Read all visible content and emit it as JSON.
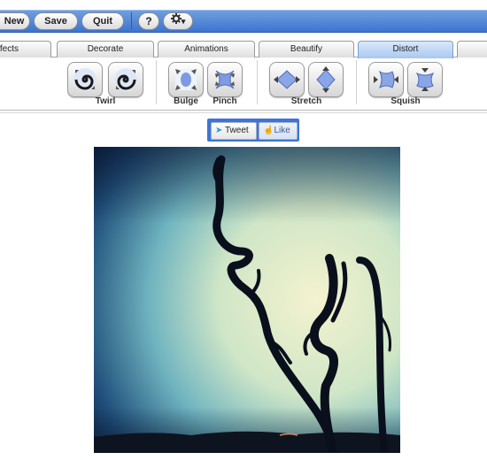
{
  "toolbar": {
    "new_label": "New",
    "save_label": "Save",
    "quit_label": "Quit",
    "help_label": "?",
    "settings_icon": "gear-icon",
    "settings_arrow": "▾"
  },
  "tabs": [
    "Effects",
    "Decorate",
    "Animations",
    "Beautify",
    "Distort",
    ""
  ],
  "active_tab": "Distort",
  "tool_groups": [
    {
      "label": "Twirl",
      "tools": [
        "twirl-left-icon",
        "twirl-right-icon"
      ]
    },
    {
      "label": "Bulge",
      "tools": [
        "bulge-icon"
      ]
    },
    {
      "label": "Pinch",
      "tools": [
        "pinch-icon"
      ]
    },
    {
      "label": "Stretch",
      "tools": [
        "stretch-horizontal-icon",
        "stretch-vertical-icon"
      ]
    },
    {
      "label": "Squish",
      "tools": [
        "squish-horizontal-icon",
        "squish-vertical-icon"
      ]
    }
  ],
  "social": {
    "tweet_label": "Tweet",
    "like_label": "Like"
  },
  "colors": {
    "toolbar_blue": "#3d74cf",
    "active_tab": "#a9c8f0",
    "social_bg": "#3f74d4",
    "tool_icon": "#6f8ed8"
  },
  "image": {
    "subject": "silhouette-of-twisted-branches-against-sky"
  }
}
